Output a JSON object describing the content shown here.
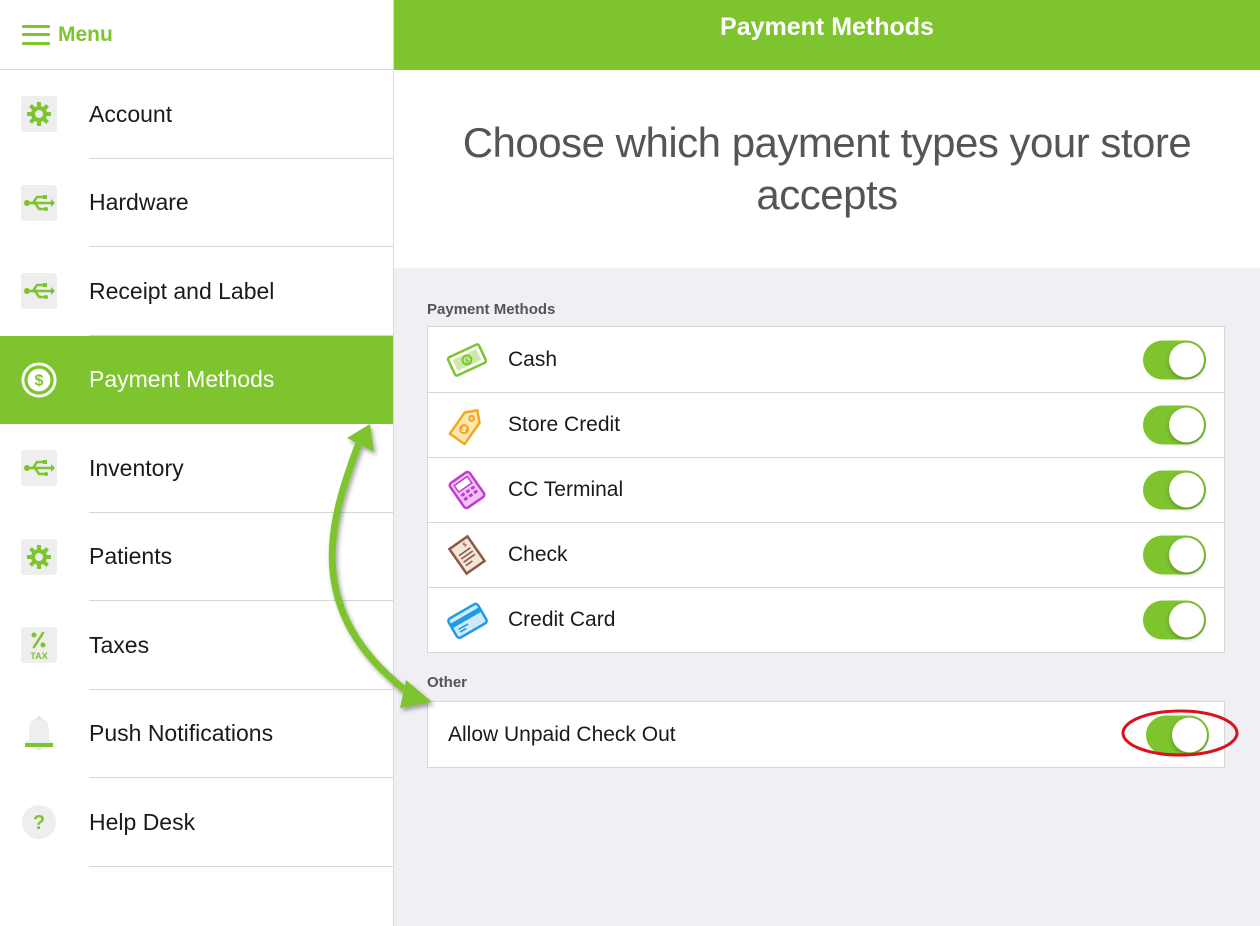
{
  "sidebar": {
    "menu_label": "Menu",
    "items": [
      {
        "label": "Account",
        "icon": "gear-icon"
      },
      {
        "label": "Hardware",
        "icon": "usb-icon"
      },
      {
        "label": "Receipt and Label",
        "icon": "usb-icon"
      },
      {
        "label": "Payment Methods",
        "icon": "dollar-circle-icon",
        "active": true
      },
      {
        "label": "Inventory",
        "icon": "usb-icon"
      },
      {
        "label": "Patients",
        "icon": "gear-icon"
      },
      {
        "label": "Taxes",
        "icon": "tax-icon",
        "icon_text": "TAX"
      },
      {
        "label": "Push Notifications",
        "icon": "bell-icon"
      },
      {
        "label": "Help Desk",
        "icon": "help-icon",
        "icon_text": "?"
      }
    ]
  },
  "header": {
    "title": "Payment Methods"
  },
  "hero": {
    "text": "Choose which payment types your store accepts"
  },
  "sections": {
    "payment_methods": {
      "title": "Payment Methods",
      "rows": [
        {
          "label": "Cash",
          "icon": "cash-icon",
          "enabled": true
        },
        {
          "label": "Store Credit",
          "icon": "tag-icon",
          "enabled": true
        },
        {
          "label": "CC Terminal",
          "icon": "terminal-icon",
          "enabled": true
        },
        {
          "label": "Check",
          "icon": "check-icon",
          "enabled": true
        },
        {
          "label": "Credit Card",
          "icon": "credit-card-icon",
          "enabled": true
        }
      ]
    },
    "other": {
      "title": "Other",
      "rows": [
        {
          "label": "Allow Unpaid Check Out",
          "enabled": true
        }
      ]
    }
  },
  "colors": {
    "accent": "#7dc42e",
    "annotation_ring": "#d9121b",
    "background": "#efeff4"
  }
}
